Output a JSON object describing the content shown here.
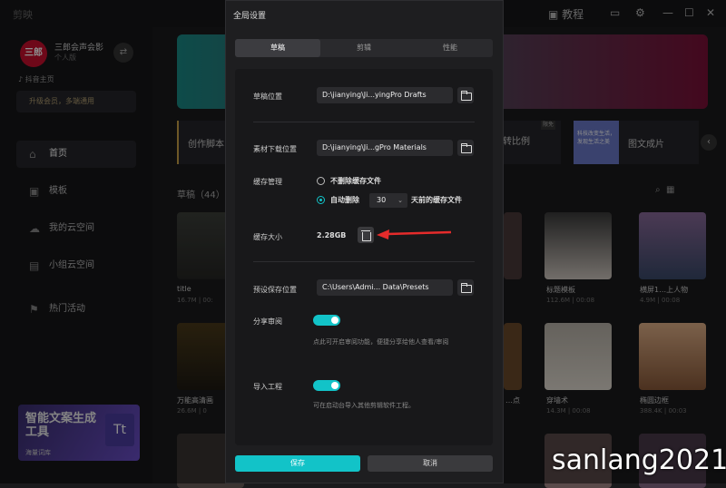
{
  "app": {
    "title": "剪映"
  },
  "topbar": {
    "tutorial": "教程"
  },
  "user": {
    "avatar_text": "三郎",
    "name": "三郎会声会影",
    "type": "个人版",
    "douyin": "抖音主页",
    "vip": "升级会员，多端通用"
  },
  "nav": [
    {
      "label": "首页",
      "icon": "home-icon"
    },
    {
      "label": "模板",
      "icon": "template-icon"
    },
    {
      "label": "我的云空间",
      "icon": "cloud-icon"
    },
    {
      "label": "小组云空间",
      "icon": "group-icon"
    },
    {
      "label": "热门活动",
      "icon": "flag-icon"
    }
  ],
  "promo": {
    "title": "智能文案生成工具",
    "sub": "海量词库",
    "badge": "Tt"
  },
  "cards": {
    "create": "创作脚本",
    "ratio": "转比例",
    "ratio_tag": "限免",
    "photo": "图文成片",
    "photo_thumb": "科技改变生活，发现生活之美"
  },
  "drafts": {
    "header": "草稿（44）",
    "items": [
      {
        "title": "title",
        "meta": "16.7M | 00:"
      },
      {
        "title": "万能高清画",
        "meta": "26.6M | 0"
      },
      {
        "title": "标题模板",
        "meta": "112.6M | 00:08"
      },
      {
        "title": "穿墙术",
        "meta": "14.3M | 00:08"
      },
      {
        "title": "横屏1…上人物",
        "meta": "4.9M | 00:08"
      },
      {
        "title": "椭圆边框",
        "meta": "388.4K | 00:03"
      },
      {
        "title": "…点",
        "meta": ""
      }
    ]
  },
  "dialog": {
    "title": "全局设置",
    "tabs": [
      "草稿",
      "剪辑",
      "性能"
    ],
    "draft_location": {
      "label": "草稿位置",
      "value": "D:\\jianying\\Ji...yingPro Drafts"
    },
    "material_location": {
      "label": "素材下载位置",
      "value": "D:\\jianying\\Ji...gPro Materials"
    },
    "cache": {
      "label": "缓存管理",
      "opt1": "不删除缓存文件",
      "opt2_prefix": "自动删除",
      "days": "30",
      "opt2_suffix": "天前的缓存文件"
    },
    "cache_size": {
      "label": "缓存大小",
      "value": "2.28GB"
    },
    "preset": {
      "label": "预设保存位置",
      "value": "C:\\Users\\Admi... Data\\Presets"
    },
    "share": {
      "label": "分享审阅",
      "hint": "点此可开启审阅功能，便捷分享给他人查看/审阅"
    },
    "import": {
      "label": "导入工程",
      "hint": "可在启动台导入其他剪辑软件工程。"
    },
    "save": "保存",
    "cancel": "取消"
  },
  "watermark": "sanlang2021",
  "colors": {
    "accent": "#12c3c8",
    "arrow": "#e52b2b"
  }
}
